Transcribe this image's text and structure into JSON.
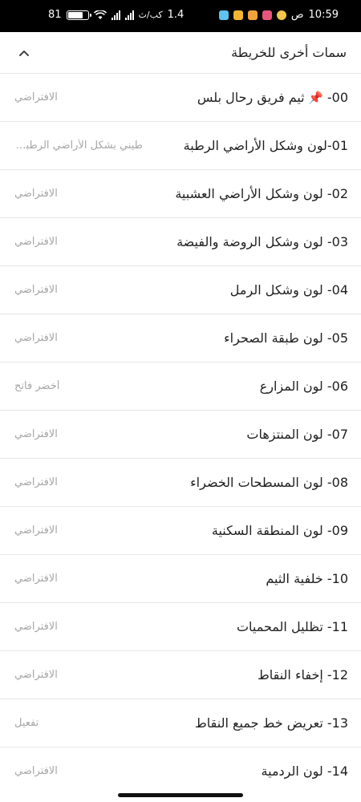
{
  "status_bar": {
    "battery_percent": "81",
    "battery_level": 0.81,
    "network_speed": "1.4",
    "network_unit": "كب/ث",
    "time": "10:59",
    "ampm": "ص"
  },
  "section": {
    "title": "سمات أخرى للخريطة"
  },
  "items": [
    {
      "title": "00- ثيم فريق رحال بلس",
      "value": "الافتراضي",
      "pinned": true
    },
    {
      "title": "01-لون وشكل الأراضي الرطبة",
      "value": "طيني بشكل الأراضي الرطبة..."
    },
    {
      "title": "02- لون وشكل الأراضي العشبية",
      "value": "الافتراضي"
    },
    {
      "title": "03- لون وشكل الروضة والفيضة",
      "value": "الافتراضي"
    },
    {
      "title": "04- لون وشكل الرمل",
      "value": "الافتراضي"
    },
    {
      "title": "05- لون طبقة الصحراء",
      "value": "الافتراضي"
    },
    {
      "title": "06- لون المزارع",
      "value": "أخضر فاتح"
    },
    {
      "title": "07- لون المنتزهات",
      "value": "الافتراضي"
    },
    {
      "title": "08- لون المسطحات الخضراء",
      "value": "الافتراضي"
    },
    {
      "title": "09- لون المنطقة السكنية",
      "value": "الافتراضي"
    },
    {
      "title": "10- خلفية الثيم",
      "value": "الافتراضي"
    },
    {
      "title": "11- تظليل المحميات",
      "value": "الافتراضي"
    },
    {
      "title": "12- إخفاء النقاط",
      "value": "الافتراضي"
    },
    {
      "title": "13- تعريض خط جميع النقاط",
      "value": "تفعيل"
    },
    {
      "title": "14- لون الردمية",
      "value": "الافتراضي"
    }
  ]
}
